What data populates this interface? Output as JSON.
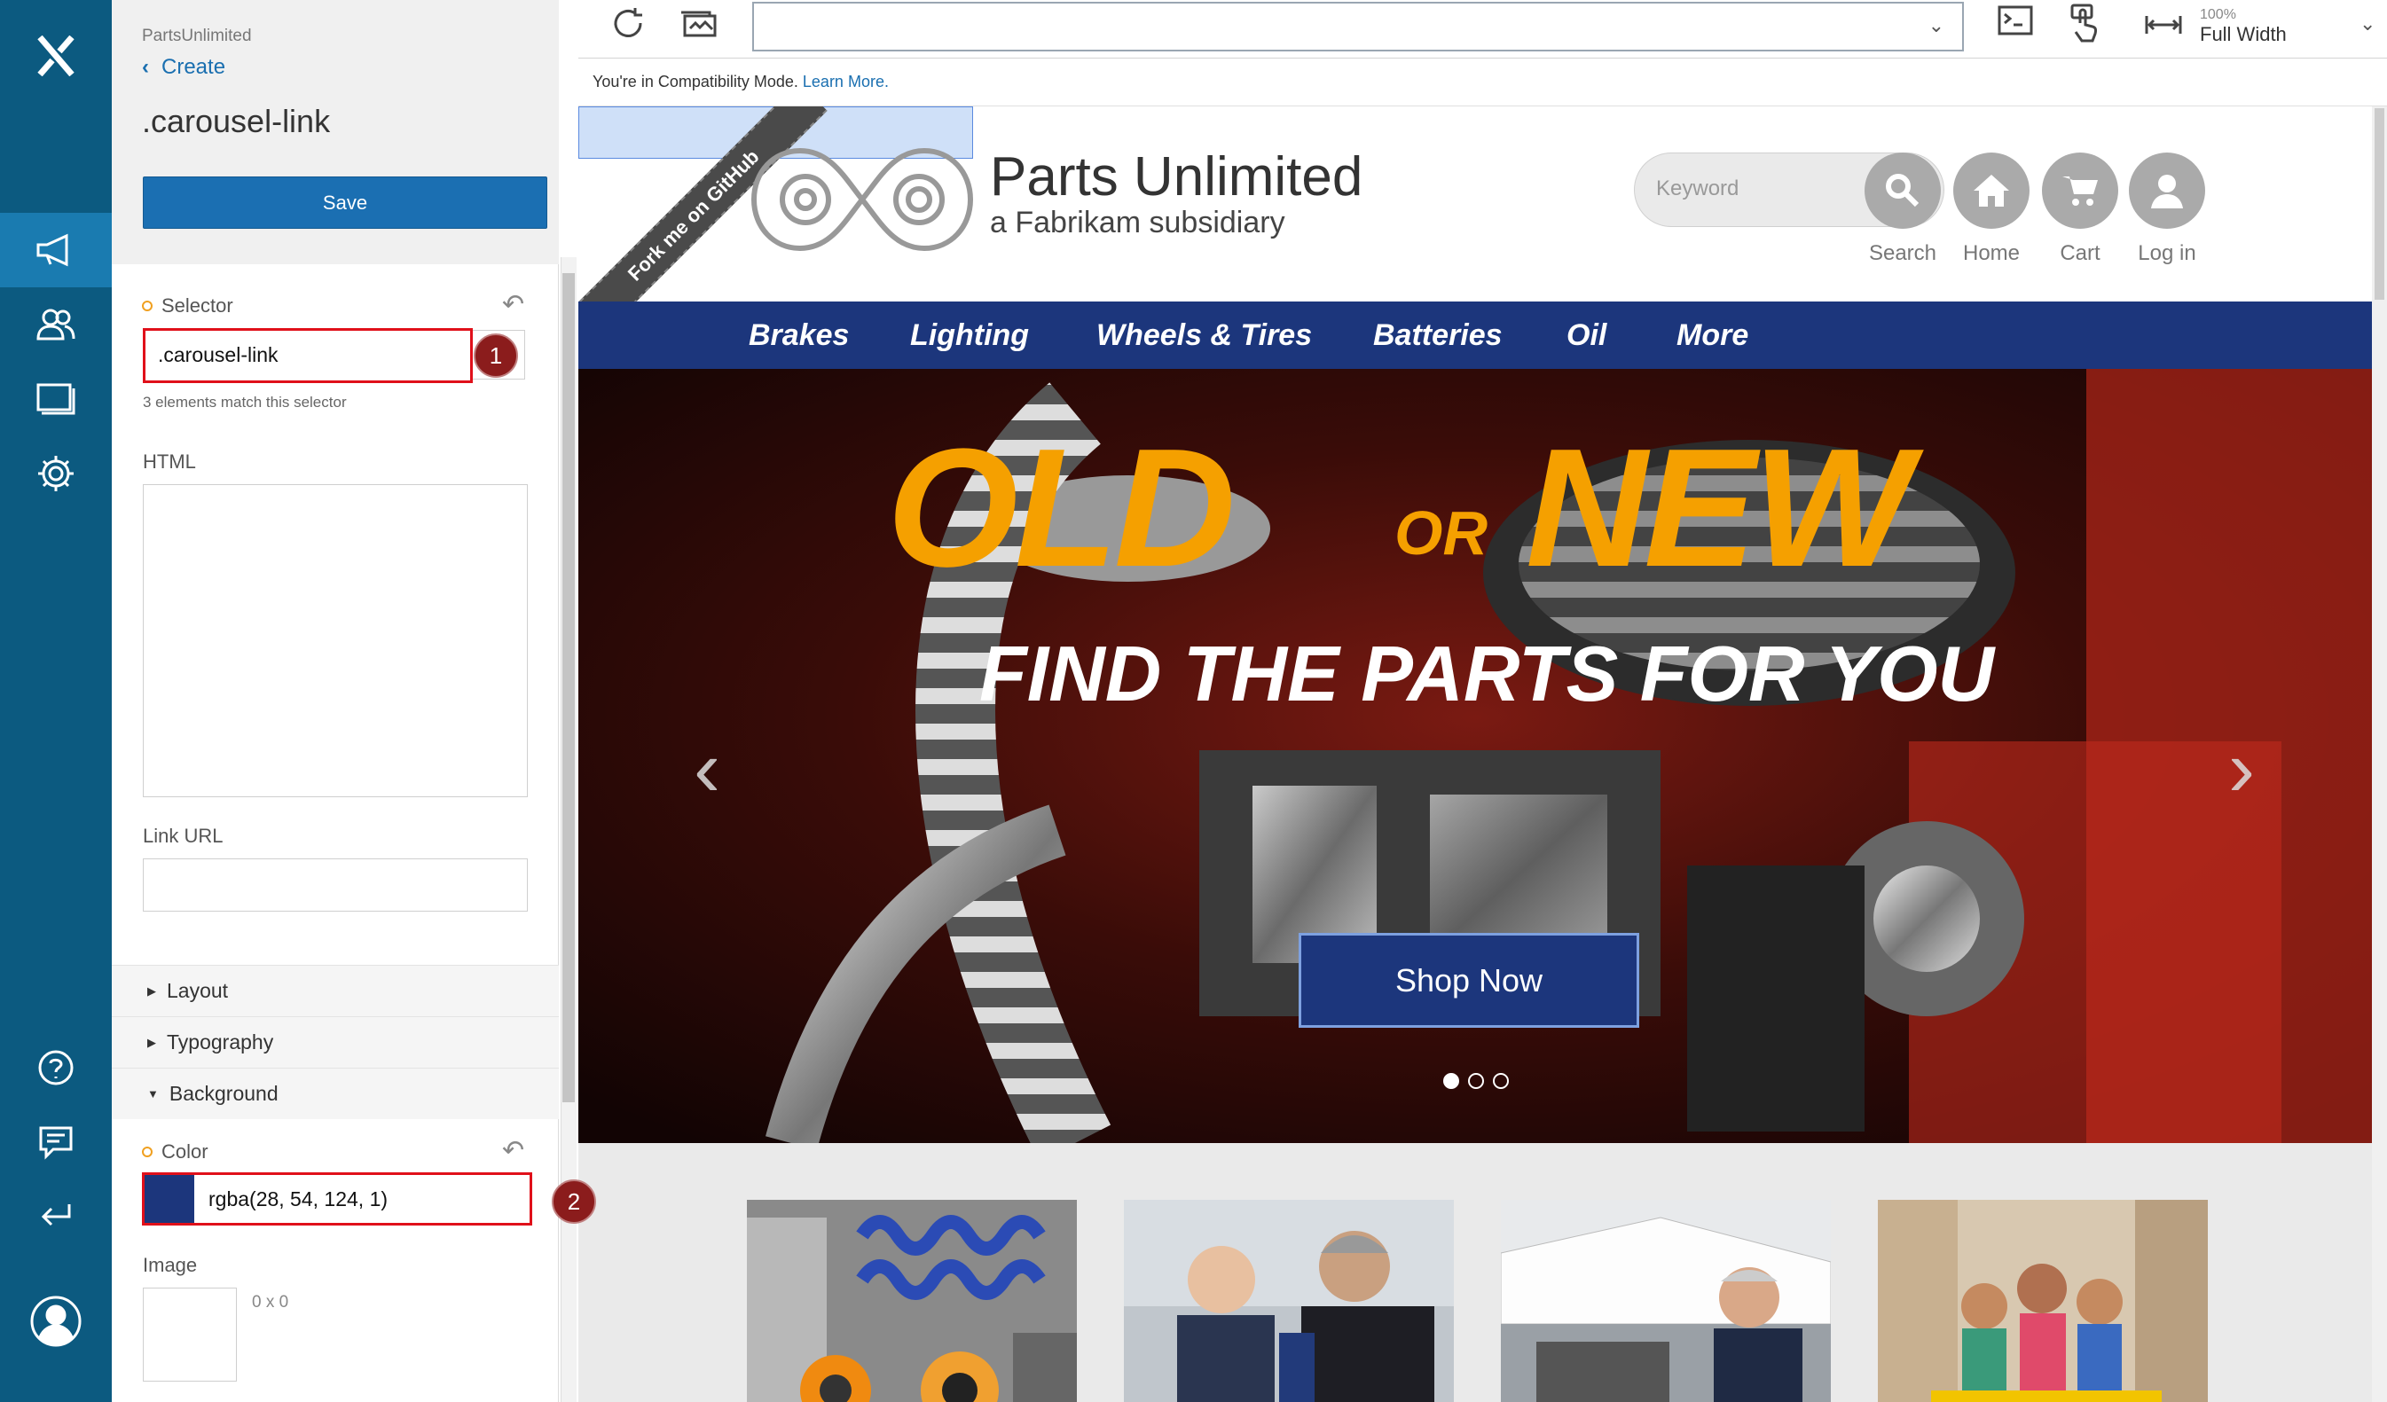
{
  "panel": {
    "project": "PartsUnlimited",
    "back_label": "Create",
    "title": ".carousel-link",
    "save_label": "Save",
    "selector": {
      "label": "Selector",
      "value": ".carousel-link",
      "badge": "1",
      "hint": "3 elements match this selector"
    },
    "html_label": "HTML",
    "link_url_label": "Link URL",
    "sections": [
      "Layout",
      "Typography",
      "Background"
    ],
    "color": {
      "label": "Color",
      "value": "rgba(28, 54, 124, 1)",
      "swatch": "#1c367c",
      "badge": "2"
    },
    "image": {
      "label": "Image",
      "size": "0 x 0"
    }
  },
  "toolbar": {
    "zoom": "100%",
    "width_mode": "Full Width"
  },
  "compat": {
    "message": "You're in Compatibility Mode.",
    "link": "Learn More."
  },
  "site": {
    "ribbon": "Fork me on GitHub",
    "brand_name": "Parts Unlimited",
    "brand_sub": "a Fabrikam subsidiary",
    "search_placeholder": "Keyword",
    "header_buttons": [
      "Search",
      "Home",
      "Cart",
      "Log in"
    ],
    "nav": [
      "Brakes",
      "Lighting",
      "Wheels & Tires",
      "Batteries",
      "Oil",
      "More"
    ],
    "hero": {
      "word_old": "OLD",
      "word_or": "OR",
      "word_new": "NEW",
      "tagline": "FIND THE PARTS FOR YOU",
      "cta": "Shop Now",
      "slides": 3,
      "active_slide": 1
    }
  },
  "colors": {
    "rail": "#0c5a80",
    "nav_blue": "#1c367c",
    "hero_orange": "#f5a000"
  }
}
